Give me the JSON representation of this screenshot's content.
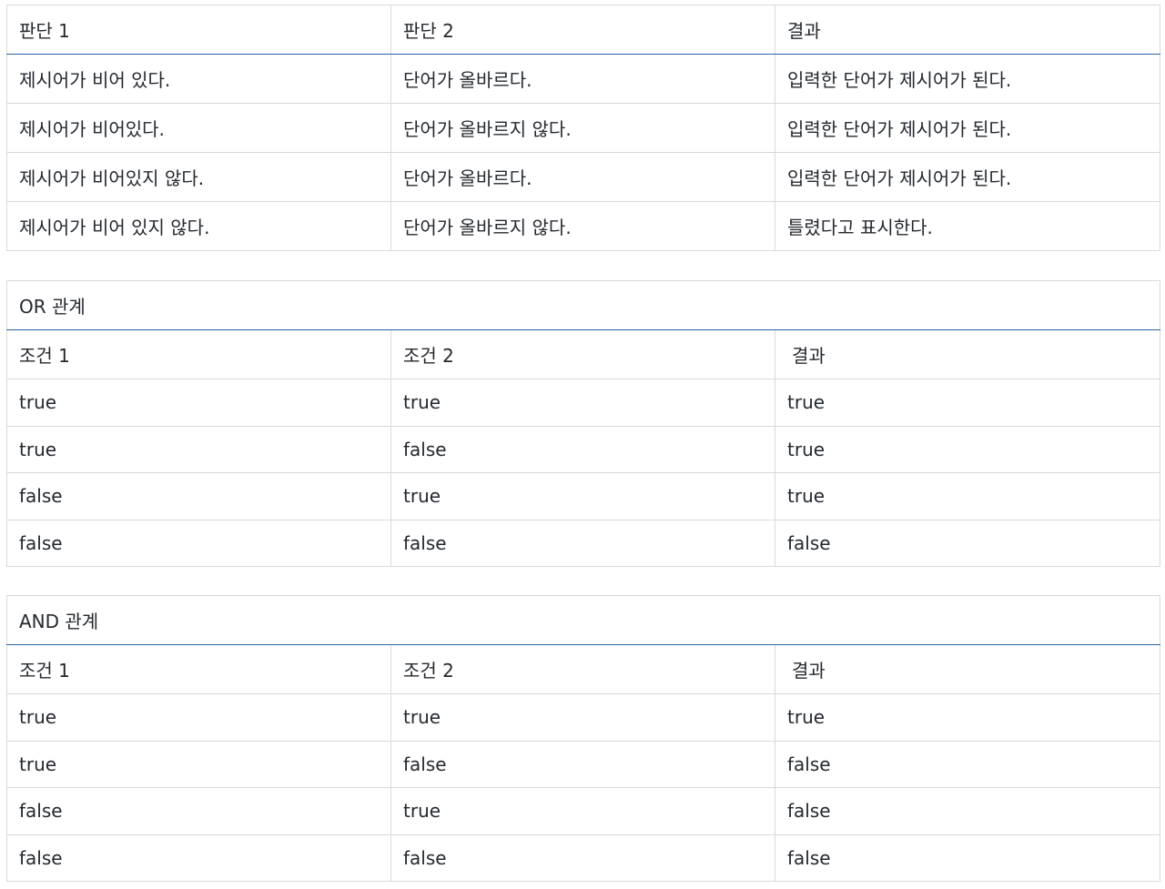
{
  "table1": {
    "headers": [
      "판단 1",
      "판단 2",
      "결과"
    ],
    "rows": [
      [
        "제시어가 비어 있다.",
        "단어가 올바르다.",
        "입력한 단어가 제시어가 된다."
      ],
      [
        "제시어가 비어있다.",
        "단어가 올바르지 않다.",
        "입력한 단어가 제시어가 된다."
      ],
      [
        "제시어가 비어있지 않다.",
        "단어가 올바르다.",
        "입력한 단어가 제시어가 된다."
      ],
      [
        "제시어가 비어 있지 않다.",
        "단어가 올바르지 않다.",
        "틀렸다고 표시한다."
      ]
    ]
  },
  "or_table": {
    "caption": "OR 관계",
    "headers": [
      "조건 1",
      "조건 2",
      "결과"
    ],
    "rows": [
      [
        "true",
        "true",
        "true"
      ],
      [
        "true",
        "false",
        "true"
      ],
      [
        "false",
        "true",
        "true"
      ],
      [
        "false",
        "false",
        "false"
      ]
    ]
  },
  "and_table": {
    "caption": "AND 관계",
    "headers": [
      "조건 1",
      "조건 2",
      "결과"
    ],
    "rows": [
      [
        "true",
        "true",
        "true"
      ],
      [
        "true",
        "false",
        "false"
      ],
      [
        "false",
        "true",
        "false"
      ],
      [
        "false",
        "false",
        "false"
      ]
    ]
  }
}
